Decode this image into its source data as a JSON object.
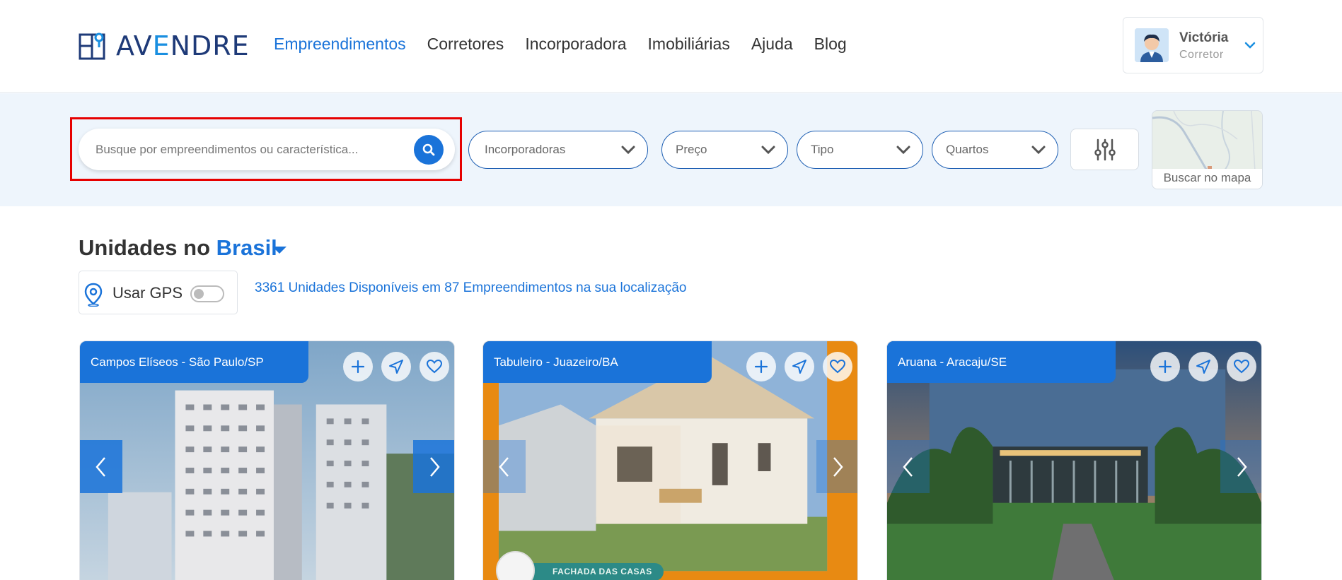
{
  "brand": {
    "logo_text_a": "AV",
    "logo_text_b": "E",
    "logo_text_c": "NDRE"
  },
  "nav": {
    "items": [
      {
        "label": "Empreendimentos",
        "active": true
      },
      {
        "label": "Corretores"
      },
      {
        "label": "Incorporadora"
      },
      {
        "label": "Imobiliárias"
      },
      {
        "label": "Ajuda"
      },
      {
        "label": "Blog"
      }
    ]
  },
  "user": {
    "name": "Victória",
    "role": "Corretor"
  },
  "search": {
    "placeholder": "Busque por empreendimentos ou característica...",
    "value": ""
  },
  "filters": {
    "incorporadoras": "Incorporadoras",
    "preco": "Preço",
    "tipo": "Tipo",
    "quartos": "Quartos",
    "map_label": "Buscar no mapa"
  },
  "section": {
    "title_prefix": "Unidades no",
    "location": "Brasil",
    "gps_label": "Usar GPS",
    "gps_enabled": false,
    "availability": "3361 Unidades Disponíveis em 87 Empreendimentos na sua localização"
  },
  "cards": [
    {
      "location": "Campos Elíseos - São Paulo/SP"
    },
    {
      "location": "Tabuleiro - Juazeiro/BA",
      "tag": "FACHADA DAS CASAS"
    },
    {
      "location": "Aruana - Aracaju/SE"
    }
  ],
  "colors": {
    "primary": "#1a73d9",
    "logo_dark": "#1e3a78",
    "highlight": "#e60000",
    "filter_bg": "#eef5fc"
  }
}
